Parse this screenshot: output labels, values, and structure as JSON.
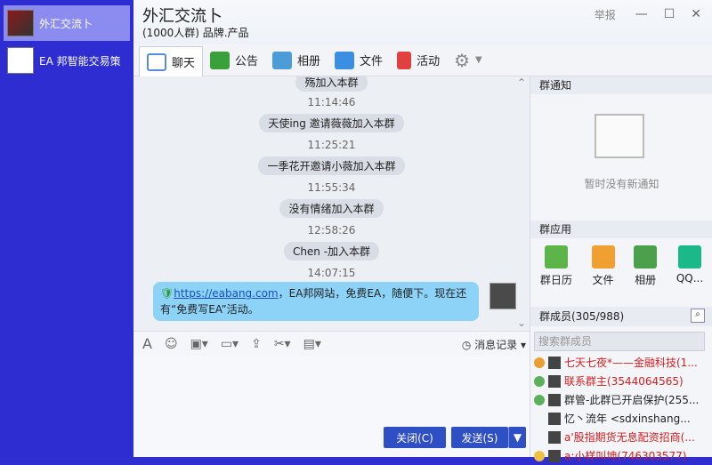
{
  "sidebar": {
    "items": [
      {
        "label": "外汇交流卜",
        "selected": true
      },
      {
        "label": "EA 邦智能交易策",
        "selected": false
      }
    ]
  },
  "header": {
    "title": "外汇交流卜",
    "subtitle": "(1000人群) 品牌.产品",
    "report": "举报"
  },
  "tabs": [
    {
      "label": "聊天"
    },
    {
      "label": "公告"
    },
    {
      "label": "相册"
    },
    {
      "label": "文件"
    },
    {
      "label": "活动"
    }
  ],
  "chat": {
    "lines": [
      {
        "kind": "pill",
        "text": "殇加入本群"
      },
      {
        "kind": "time",
        "text": "11:14:46"
      },
      {
        "kind": "pill",
        "text": "天使ing 邀请薇薇加入本群"
      },
      {
        "kind": "time",
        "text": "11:25:21"
      },
      {
        "kind": "pill",
        "text": "一季花开邀请小薇加入本群"
      },
      {
        "kind": "time",
        "text": "11:55:34"
      },
      {
        "kind": "pill",
        "text": "没有情绪加入本群"
      },
      {
        "kind": "time",
        "text": "12:58:26"
      },
      {
        "kind": "pill",
        "text": "Chen -加入本群"
      },
      {
        "kind": "time",
        "text": "14:07:15"
      }
    ],
    "bubble_link": "https://eabang.com",
    "bubble_text": "，EA邦网站，免费EA，随便下。现在还有“免费写EA”活动。"
  },
  "input": {
    "record": "消息记录",
    "close": "关闭(C)",
    "send": "发送(S)"
  },
  "panel": {
    "notice_title": "群通知",
    "notice_empty": "暂时没有新通知",
    "apps_title": "群应用",
    "apps": [
      {
        "label": "群日历",
        "color": "#5db54a"
      },
      {
        "label": "文件",
        "color": "#f0a030"
      },
      {
        "label": "相册",
        "color": "#4ca04c"
      },
      {
        "label": "QQ...",
        "color": "#1bb88a"
      }
    ],
    "members_title": "群成员(305/988)",
    "search_placeholder": "搜索群成员",
    "members": [
      {
        "name": "七天七夜*——金融科技(1...",
        "color": "#d21e1e"
      },
      {
        "name": "联系群主(3544064565)",
        "color": "#d21e1e"
      },
      {
        "name": "群管-此群已开启保护(255...",
        "color": "#222"
      },
      {
        "name": "忆丶流年 <sdxinshang...",
        "color": "#222"
      },
      {
        "name": "a'股指期货无息配资招商(...",
        "color": "#d21e1e"
      },
      {
        "name": "a:小样叫坤(746303577)",
        "color": "#d21e1e"
      }
    ]
  }
}
